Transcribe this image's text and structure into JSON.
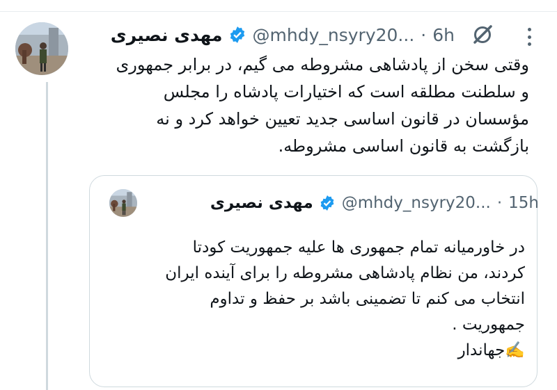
{
  "tweet": {
    "author_name": "مهدی نصیری",
    "handle": "@mhdy_nsyry20...",
    "separator": "·",
    "time": "6h",
    "text": "وقتی سخن از پادشاهی مشروطه می گیم، در برابر جمهوری\nو سلطنت مطلقه است که اختیارات پادشاه را مجلس\nمؤسسان در قانون اساسی جدید تعیین خواهد کرد و نه\nبازگشت به قانون اساسی مشروطه.",
    "verified": true
  },
  "quoted_tweet": {
    "author_name": "مهدی نصیری",
    "handle": "@mhdy_nsyry20...",
    "separator": "·",
    "time": "15h",
    "text": "در خاورمیانه تمام جمهوری ها علیه جمهوریت کودتا\nکردند، من نظام پادشاهی مشروطه را برای آینده ایران\nانتخاب می کنم تا تضمینی باشد بر حفظ و تداوم\nجمهوریت .\n✍️جهاندار",
    "verified": true
  },
  "colors": {
    "text": "#0f1419",
    "secondary": "#536471",
    "verified_blue": "#1d9bf0",
    "border": "#cfd9de"
  },
  "icons": [
    "verified-badge-icon",
    "grok-slash-icon",
    "more-options-icon"
  ]
}
